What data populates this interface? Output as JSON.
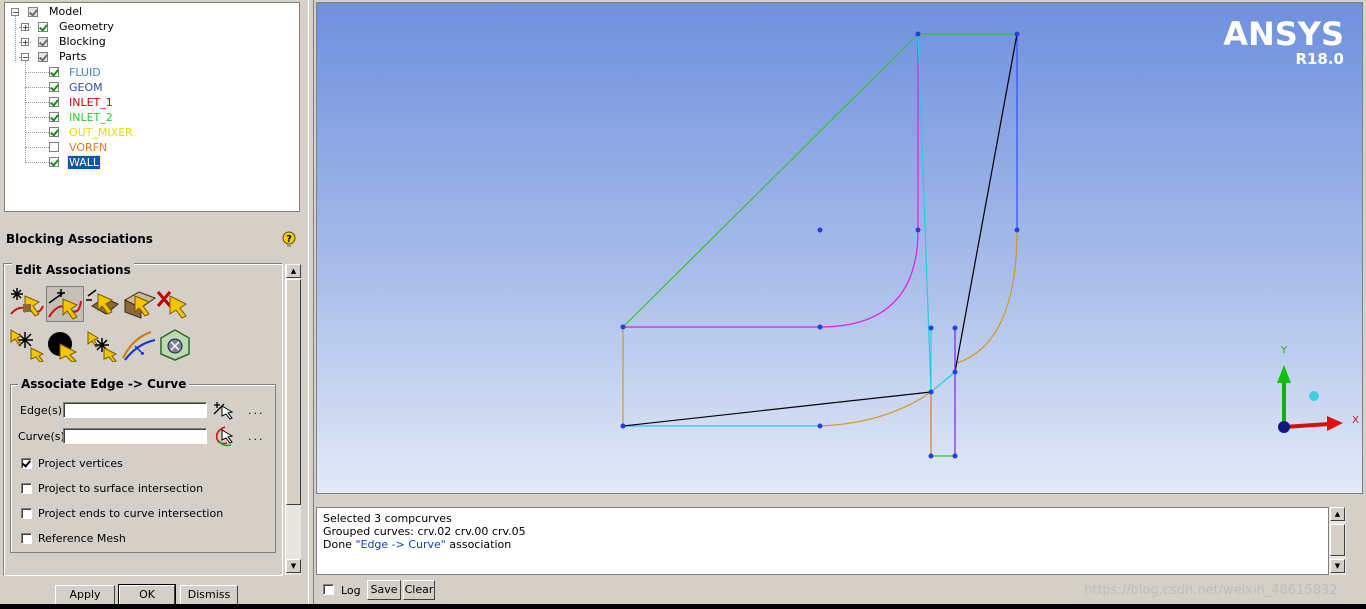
{
  "tree": {
    "model": "Model",
    "geometry": "Geometry",
    "blocking": "Blocking",
    "parts": "Parts",
    "part_items": [
      {
        "label": "FLUID",
        "color": "#3a86c8",
        "checked": true
      },
      {
        "label": "GEOM",
        "color": "#2b4ea8",
        "checked": true
      },
      {
        "label": "INLET_1",
        "color": "#d00000",
        "checked": true
      },
      {
        "label": "INLET_2",
        "color": "#2ec82e",
        "checked": true
      },
      {
        "label": "OUT_MIXER",
        "color": "#e0e000",
        "checked": true
      },
      {
        "label": "VORFN",
        "color": "#e07a1a",
        "checked": false
      },
      {
        "label": "WALL",
        "color": "#ffffff",
        "checked": true,
        "selected": true
      }
    ]
  },
  "panel": {
    "title": "Blocking Associations",
    "edit_group": "Edit Associations",
    "assoc_group": "Associate Edge -> Curve",
    "edges_label": "Edge(s)",
    "curves_label": "Curve(s)",
    "edges_value": "",
    "curves_value": "",
    "more": "...",
    "options": [
      {
        "label": "Project vertices",
        "checked": true
      },
      {
        "label": "Project to surface intersection",
        "checked": false
      },
      {
        "label": "Project ends to curve intersection",
        "checked": false
      },
      {
        "label": "Reference Mesh",
        "checked": false
      }
    ],
    "buttons": {
      "apply": "Apply",
      "ok": "OK",
      "dismiss": "Dismiss"
    }
  },
  "viewport": {
    "brand": "ANSYS",
    "version": "R18.0",
    "axis_x": "X",
    "axis_y": "Y"
  },
  "messages": {
    "lines": [
      "Selected 3 compcurves",
      "Grouped curves: crv.02 crv.00 crv.05"
    ],
    "done_prefix": "Done ",
    "done_quoted": "\"Edge -> Curve\"",
    "done_suffix": " association"
  },
  "bottom": {
    "log_label": "Log",
    "log_checked": false,
    "save": "Save",
    "clear": "Clear"
  },
  "watermark": "https://blog.csdn.net/weixin_48615832"
}
